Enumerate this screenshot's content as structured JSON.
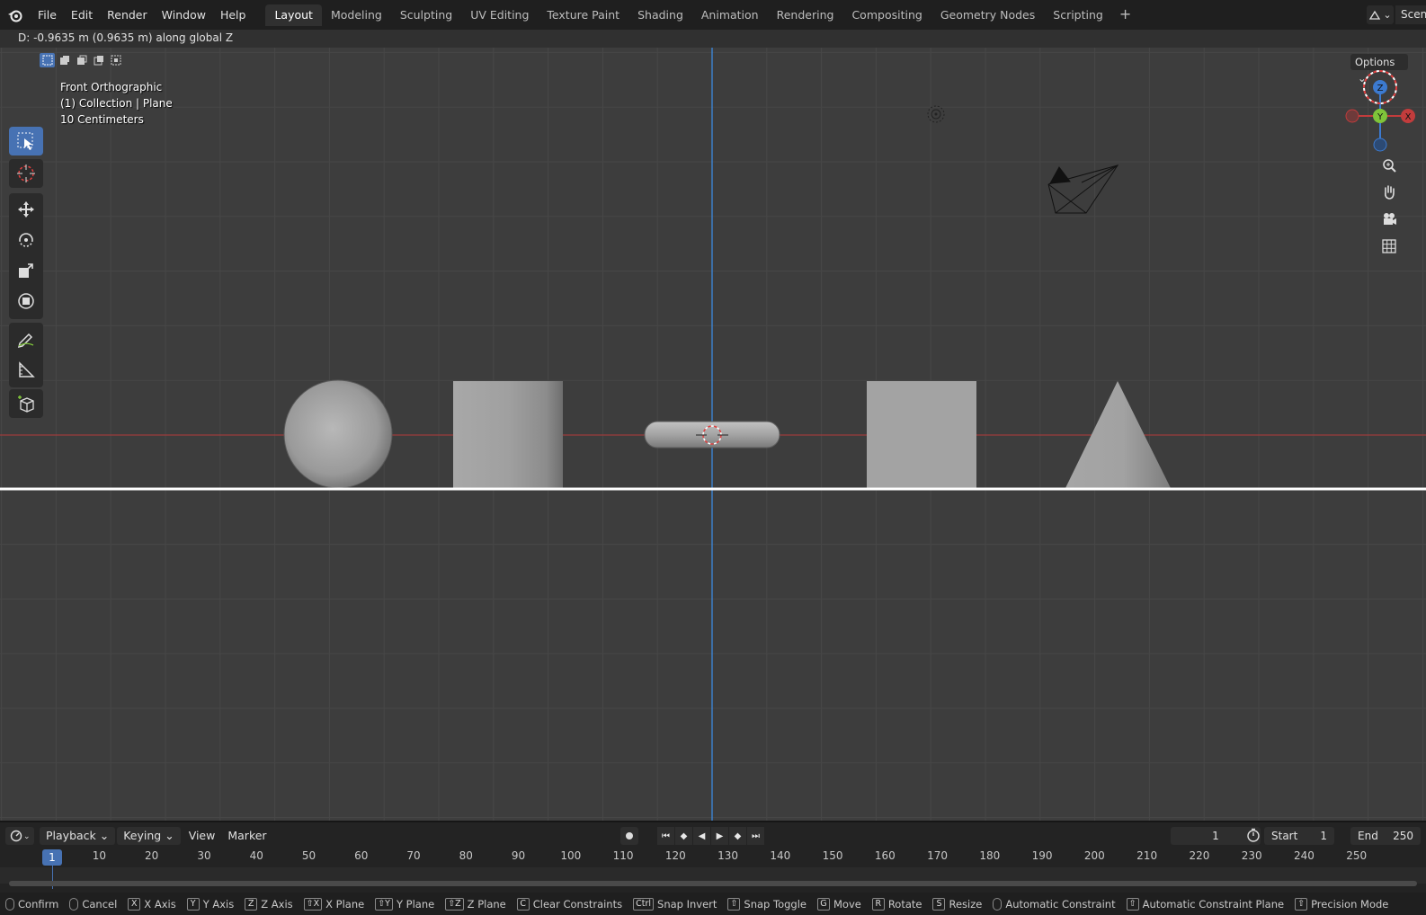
{
  "app": {
    "name": "Blender"
  },
  "menu": [
    "File",
    "Edit",
    "Render",
    "Window",
    "Help"
  ],
  "workspaces": [
    "Layout",
    "Modeling",
    "Sculpting",
    "UV Editing",
    "Texture Paint",
    "Shading",
    "Animation",
    "Rendering",
    "Compositing",
    "Geometry Nodes",
    "Scripting"
  ],
  "active_workspace": "Layout",
  "scene_label": "Scen",
  "operator_status": "D: -0.9635 m (0.9635 m) along global Z",
  "viewport": {
    "view_name": "Front Orthographic",
    "collection": "(1) Collection | Plane",
    "grid_scale": "10 Centimeters",
    "options_label": "Options",
    "gizmo_axes": {
      "z": "Z",
      "y": "Y",
      "x": "X"
    },
    "colors": {
      "background": "#3d3d3d",
      "x_axis": "#b33b3b",
      "z_axis": "#3c8ae0",
      "selected_plane": "#ffffff"
    }
  },
  "timeline": {
    "editor_menus": [
      "Playback",
      "Keying",
      "View",
      "Marker"
    ],
    "current_frame": "1",
    "start_label": "Start",
    "start_value": "1",
    "end_label": "End",
    "end_value": "250",
    "ruler_marks": [
      "1",
      "10",
      "20",
      "30",
      "40",
      "50",
      "60",
      "70",
      "80",
      "90",
      "100",
      "110",
      "120",
      "130",
      "140",
      "150",
      "160",
      "170",
      "180",
      "190",
      "200",
      "210",
      "220",
      "230",
      "240",
      "250"
    ]
  },
  "statusbar": [
    {
      "key": "mouse",
      "label": "Confirm"
    },
    {
      "key": "mouse",
      "label": "Cancel"
    },
    {
      "key": "X",
      "label": "X Axis"
    },
    {
      "key": "Y",
      "label": "Y Axis"
    },
    {
      "key": "Z",
      "label": "Z Axis"
    },
    {
      "key": "⇧X",
      "label": "X Plane"
    },
    {
      "key": "⇧Y",
      "label": "Y Plane"
    },
    {
      "key": "⇧Z",
      "label": "Z Plane"
    },
    {
      "key": "C",
      "label": "Clear Constraints"
    },
    {
      "key": "Ctrl",
      "label": "Snap Invert"
    },
    {
      "key": "⇧",
      "label": "Snap Toggle"
    },
    {
      "key": "G",
      "label": "Move"
    },
    {
      "key": "R",
      "label": "Rotate"
    },
    {
      "key": "S",
      "label": "Resize"
    },
    {
      "key": "mouse",
      "label": "Automatic Constraint"
    },
    {
      "key": "⇧",
      "label": "Automatic Constraint Plane"
    },
    {
      "key": "⇧",
      "label": "Precision Mode"
    }
  ]
}
